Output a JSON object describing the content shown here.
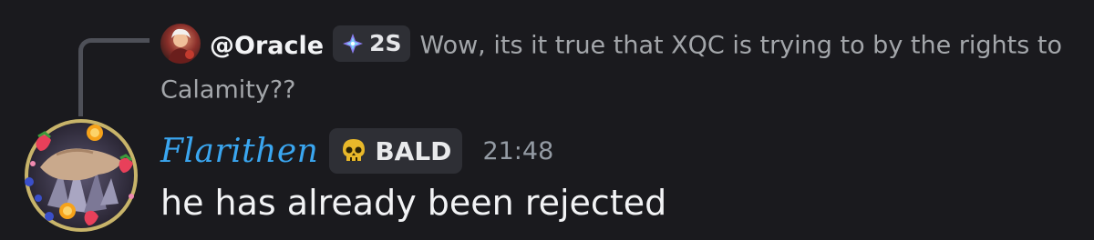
{
  "reply": {
    "username": "@Oracle",
    "tag_label": "2S",
    "tag_icon": "sparkle-diamond-icon",
    "text": "Wow, its it true that XQC is trying to by the rights to Calamity??"
  },
  "message": {
    "author": "Flarithen",
    "author_color": "#3aa6f0",
    "role_tag_label": "BALD",
    "role_tag_icon": "skull-icon",
    "timestamp": "21:48",
    "content": "he has already been rejected"
  }
}
